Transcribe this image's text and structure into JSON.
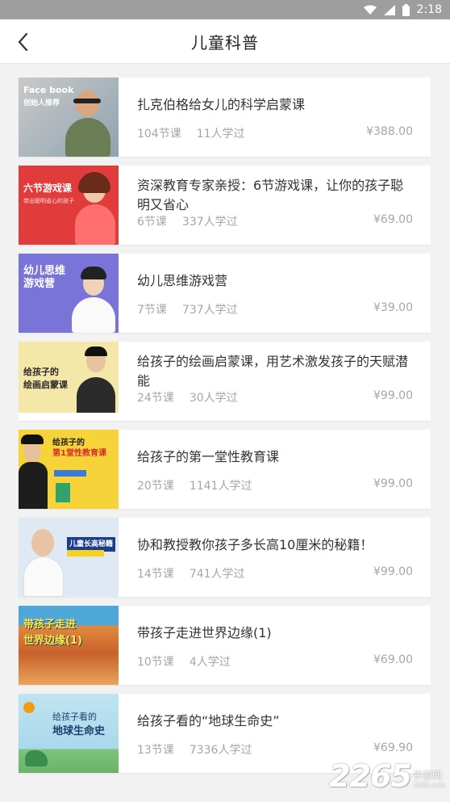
{
  "status": {
    "time": "2:18"
  },
  "header": {
    "title": "儿童科普"
  },
  "courses": [
    {
      "title": "扎克伯格给女儿的科学启蒙课",
      "lessons": "104节课",
      "learners": "11人学过",
      "price": "¥388.00",
      "thumb": {
        "bg": "#b8b8b8",
        "lines": [
          "Face book",
          "创始人推荐"
        ]
      }
    },
    {
      "title": "资深教育专家亲授：6节游戏课，让你的孩子聪明又省心",
      "lessons": "6节课",
      "learners": "337人学过",
      "price": "¥69.00",
      "thumb": {
        "bg": "#e23b3b",
        "lines": [
          "六节游戏课"
        ]
      }
    },
    {
      "title": "幼儿思维游戏营",
      "lessons": "7节课",
      "learners": "737人学过",
      "price": "¥39.00",
      "thumb": {
        "bg": "#7a74d8",
        "lines": [
          "幼儿思维",
          "游戏营"
        ]
      }
    },
    {
      "title": "给孩子的绘画启蒙课，用艺术激发孩子的天赋潜能",
      "lessons": "24节课",
      "learners": "30人学过",
      "price": "¥99.00",
      "thumb": {
        "bg": "#f4e7a8",
        "lines": [
          "给孩子的",
          "绘画启蒙课"
        ]
      }
    },
    {
      "title": "给孩子的第一堂性教育课",
      "lessons": "20节课",
      "learners": "1141人学过",
      "price": "¥99.00",
      "thumb": {
        "bg": "#f7d33a",
        "lines": [
          "给孩子的",
          "第1堂性教育课"
        ]
      }
    },
    {
      "title": "协和教授教你孩子多长高10厘米的秘籍！",
      "lessons": "14节课",
      "learners": "741人学过",
      "price": "¥99.00",
      "thumb": {
        "bg": "#dfe9f4",
        "lines": [
          "儿童长高秘籍"
        ]
      }
    },
    {
      "title": "带孩子走进世界边缘(1)",
      "lessons": "10节课",
      "learners": "4人学过",
      "price": "¥69.00",
      "thumb": {
        "bg": "#d9813a",
        "lines": [
          "带孩子走进",
          "世界边缘(1)"
        ]
      }
    },
    {
      "title": "给孩子看的“地球生命史”",
      "lessons": "13节课",
      "learners": "7336人学过",
      "price": "¥69.90",
      "thumb": {
        "bg": "#a9d8ea",
        "lines": [
          "给孩子看的",
          "地球生命史"
        ]
      }
    }
  ],
  "watermark": {
    "number": "2265",
    "label": "手游网",
    "url": "2265.com"
  }
}
